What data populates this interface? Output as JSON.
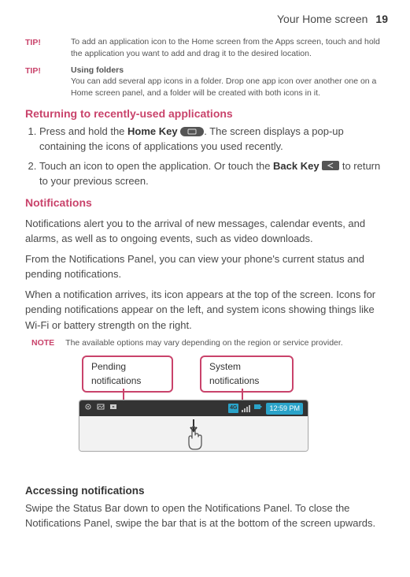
{
  "header": {
    "section": "Your Home screen",
    "page": "19"
  },
  "tip1": {
    "label": "TIP!",
    "text": "To add an application icon to the Home screen from the Apps screen, touch and hold the application you want to add and drag it to the desired location."
  },
  "tip2": {
    "label": "TIP!",
    "bold": "Using folders",
    "text": "You can add several app icons in a folder. Drop one app icon over another one on a Home screen panel, and a folder will be created with both icons in it."
  },
  "sec_return": {
    "title": "Returning to recently-used applications",
    "item1_a": "Press and hold the ",
    "item1_b": "Home Key",
    "item1_c": ". The screen displays a pop-up containing the icons of applications you used recently.",
    "item2_a": "Touch an icon to open the application. Or touch the ",
    "item2_b": "Back Key",
    "item2_c": " to return to your previous screen."
  },
  "sec_notif": {
    "title": "Notifications",
    "p1": "Notifications alert you to the arrival of new messages, calendar events, and alarms, as well as to ongoing events, such as video downloads.",
    "p2": "From the Notifications Panel, you can view your phone's current status and pending notifications.",
    "p3": "When a notification arrives, its icon appears at the top of the screen. Icons for pending notifications appear on the left, and system icons showing things like Wi-Fi or battery strength on the right."
  },
  "note": {
    "label": "NOTE",
    "text": "The available options may vary depending on the region or service provider."
  },
  "diagram": {
    "pending": "Pending notifications",
    "system": "System notifications",
    "time": "12:59 PM",
    "badge": "4G"
  },
  "sec_access": {
    "title": "Accessing notifications",
    "p": "Swipe the Status Bar down to open the Notifications Panel. To close the Notifications Panel, swipe the bar that is at the bottom of the screen upwards."
  }
}
